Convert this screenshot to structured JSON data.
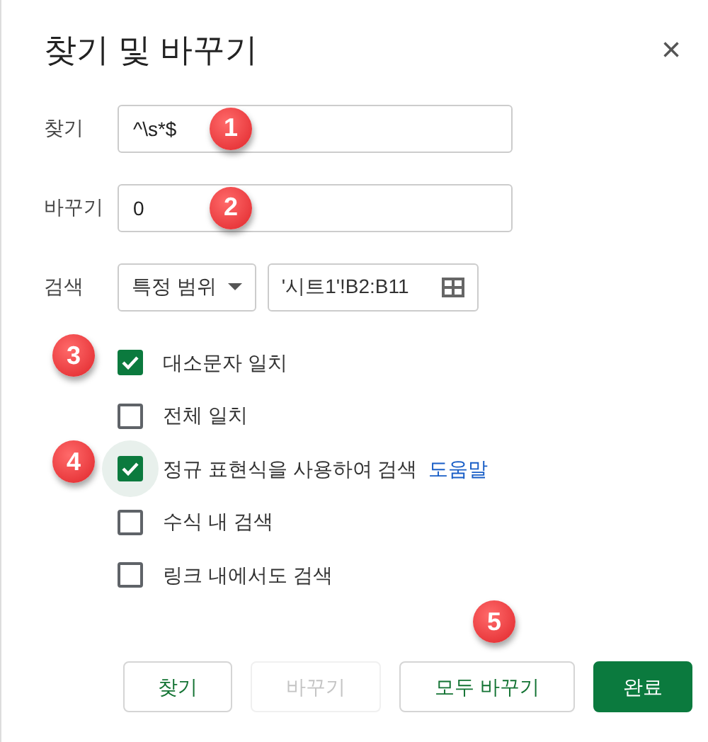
{
  "dialog": {
    "title": "찾기 및 바꾸기",
    "close": "×"
  },
  "fields": [
    {
      "label": "찾기",
      "value": "^\\s*$",
      "callout": "1"
    },
    {
      "label": "바꾸기",
      "value": "0",
      "callout": "2"
    }
  ],
  "search": {
    "label": "검색",
    "scope": "특정 범위",
    "range": "'시트1'!B2:B11"
  },
  "options": [
    {
      "label": "대소문자 일치",
      "checked": true,
      "focused": false,
      "callout": "3"
    },
    {
      "label": "전체 일치",
      "checked": false,
      "focused": false
    },
    {
      "label": "정규 표현식을 사용하여 검색",
      "link": "도움말",
      "checked": true,
      "focused": true,
      "callout": "4"
    },
    {
      "label": "수식 내 검색",
      "checked": false,
      "focused": false
    },
    {
      "label": "링크 내에서도 검색",
      "checked": false,
      "focused": false
    }
  ],
  "buttons": [
    {
      "label": "찾기",
      "kind": "outline"
    },
    {
      "label": "바꾸기",
      "kind": "disabled"
    },
    {
      "label": "모두 바꾸기",
      "kind": "outline",
      "callout": "5"
    },
    {
      "label": "완료",
      "kind": "primary"
    }
  ]
}
